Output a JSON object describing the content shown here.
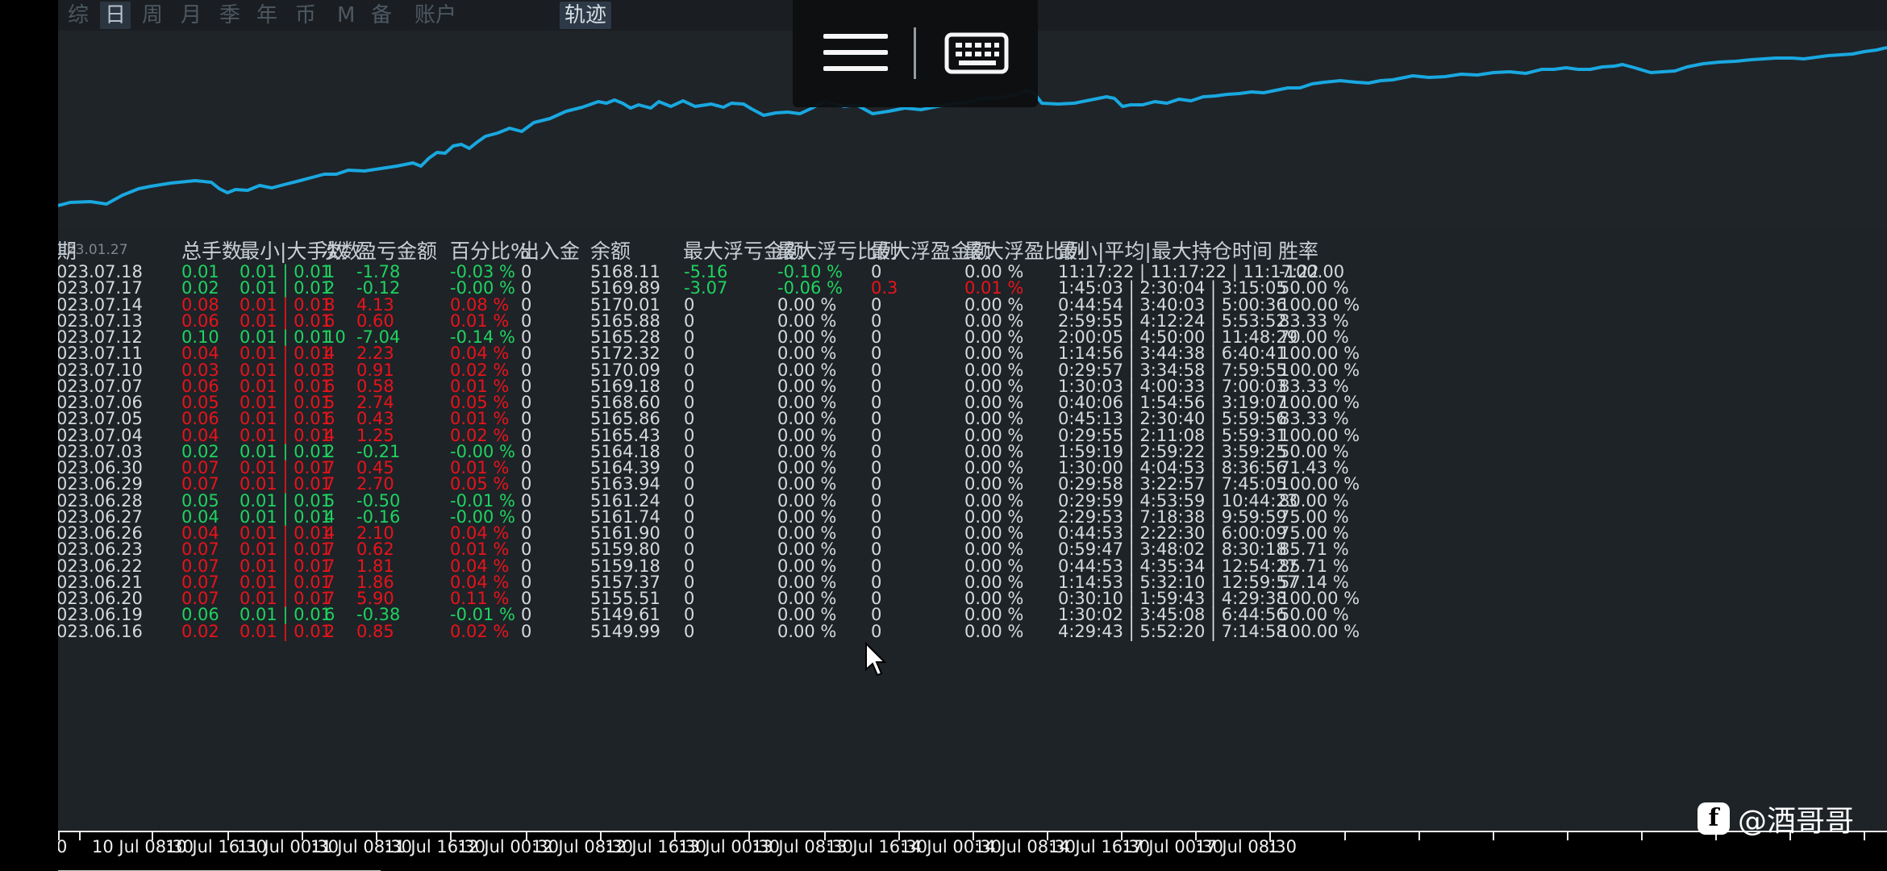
{
  "toolbar": {
    "periods": [
      "综",
      "日",
      "周",
      "月",
      "季",
      "年",
      "币",
      "M",
      "备",
      "账户"
    ],
    "active_period": "日",
    "track_button": "轨迹"
  },
  "chart": {
    "start_label": "023.01.27",
    "line_color": "#19a8e0",
    "background": "#1f2429"
  },
  "overlay": {
    "left_icon": "hamburger-menu-icon",
    "right_icon": "keyboard-icon"
  },
  "table": {
    "headers": [
      "期",
      "总手数",
      "最小|大手数",
      "次数",
      "盈亏金额",
      "百分比%",
      "出入金",
      "余额",
      "最大浮亏金额",
      "最大浮亏比例",
      "最大浮盈金额",
      "最大浮盈比例",
      "最小|平均|最大持仓时间",
      "胜率"
    ],
    "rows": [
      {
        "date": "023.07.18",
        "lots": "0.01",
        "minmax": "0.01 | 0.01",
        "count": "1",
        "pnl": "-1.78",
        "pct": "-0.03 %",
        "inout": "0",
        "balance": "5168.11",
        "maxloss": "-5.16",
        "maxloss_pct": "-0.10 %",
        "maxprofit": "0",
        "maxprofit_pct": "0.00 %",
        "hold": "11:17:22 | 11:17:22 | 11:17:22",
        "win": "-100.00",
        "color": "g",
        "loss_color": "g",
        "profit_color": "w"
      },
      {
        "date": "023.07.17",
        "lots": "0.02",
        "minmax": "0.01 | 0.01",
        "count": "2",
        "pnl": "-0.12",
        "pct": "-0.00 %",
        "inout": "0",
        "balance": "5169.89",
        "maxloss": "-3.07",
        "maxloss_pct": "-0.06 %",
        "maxprofit": "0.3",
        "maxprofit_pct": "0.01 %",
        "hold": "1:45:03 | 2:30:04 | 3:15:05",
        "win": "50.00 %",
        "color": "g",
        "loss_color": "g",
        "profit_color": "r"
      },
      {
        "date": "023.07.14",
        "lots": "0.08",
        "minmax": "0.01 | 0.01",
        "count": "8",
        "pnl": "4.13",
        "pct": "0.08 %",
        "inout": "0",
        "balance": "5170.01",
        "maxloss": "0",
        "maxloss_pct": "0.00 %",
        "maxprofit": "0",
        "maxprofit_pct": "0.00 %",
        "hold": "0:44:54 | 3:40:03 | 5:00:36",
        "win": "100.00 %",
        "color": "r",
        "loss_color": "w",
        "profit_color": "w"
      },
      {
        "date": "023.07.13",
        "lots": "0.06",
        "minmax": "0.01 | 0.01",
        "count": "6",
        "pnl": "0.60",
        "pct": "0.01 %",
        "inout": "0",
        "balance": "5165.88",
        "maxloss": "0",
        "maxloss_pct": "0.00 %",
        "maxprofit": "0",
        "maxprofit_pct": "0.00 %",
        "hold": "2:59:55 | 4:12:24 | 5:53:52",
        "win": "83.33 %",
        "color": "r",
        "loss_color": "w",
        "profit_color": "w"
      },
      {
        "date": "023.07.12",
        "lots": "0.10",
        "minmax": "0.01 | 0.01",
        "count": "10",
        "pnl": "-7.04",
        "pct": "-0.14 %",
        "inout": "0",
        "balance": "5165.28",
        "maxloss": "0",
        "maxloss_pct": "0.00 %",
        "maxprofit": "0",
        "maxprofit_pct": "0.00 %",
        "hold": "2:00:05 | 4:50:00 | 11:48:29",
        "win": "70.00 %",
        "color": "g",
        "loss_color": "w",
        "profit_color": "w"
      },
      {
        "date": "023.07.11",
        "lots": "0.04",
        "minmax": "0.01 | 0.01",
        "count": "4",
        "pnl": "2.23",
        "pct": "0.04 %",
        "inout": "0",
        "balance": "5172.32",
        "maxloss": "0",
        "maxloss_pct": "0.00 %",
        "maxprofit": "0",
        "maxprofit_pct": "0.00 %",
        "hold": "1:14:56 | 3:44:38 | 6:40:41",
        "win": "100.00 %",
        "color": "r",
        "loss_color": "w",
        "profit_color": "w"
      },
      {
        "date": "023.07.10",
        "lots": "0.03",
        "minmax": "0.01 | 0.01",
        "count": "3",
        "pnl": "0.91",
        "pct": "0.02 %",
        "inout": "0",
        "balance": "5170.09",
        "maxloss": "0",
        "maxloss_pct": "0.00 %",
        "maxprofit": "0",
        "maxprofit_pct": "0.00 %",
        "hold": "0:29:57 | 3:34:58 | 7:59:55",
        "win": "100.00 %",
        "color": "r",
        "loss_color": "w",
        "profit_color": "w"
      },
      {
        "date": "023.07.07",
        "lots": "0.06",
        "minmax": "0.01 | 0.01",
        "count": "6",
        "pnl": "0.58",
        "pct": "0.01 %",
        "inout": "0",
        "balance": "5169.18",
        "maxloss": "0",
        "maxloss_pct": "0.00 %",
        "maxprofit": "0",
        "maxprofit_pct": "0.00 %",
        "hold": "1:30:03 | 4:00:33 | 7:00:03",
        "win": "83.33 %",
        "color": "r",
        "loss_color": "w",
        "profit_color": "w"
      },
      {
        "date": "023.07.06",
        "lots": "0.05",
        "minmax": "0.01 | 0.01",
        "count": "5",
        "pnl": "2.74",
        "pct": "0.05 %",
        "inout": "0",
        "balance": "5168.60",
        "maxloss": "0",
        "maxloss_pct": "0.00 %",
        "maxprofit": "0",
        "maxprofit_pct": "0.00 %",
        "hold": "0:40:06 | 1:54:56 | 3:19:07",
        "win": "100.00 %",
        "color": "r",
        "loss_color": "w",
        "profit_color": "w"
      },
      {
        "date": "023.07.05",
        "lots": "0.06",
        "minmax": "0.01 | 0.01",
        "count": "6",
        "pnl": "0.43",
        "pct": "0.01 %",
        "inout": "0",
        "balance": "5165.86",
        "maxloss": "0",
        "maxloss_pct": "0.00 %",
        "maxprofit": "0",
        "maxprofit_pct": "0.00 %",
        "hold": "0:45:13 | 2:30:40 | 5:59:56",
        "win": "83.33 %",
        "color": "r",
        "loss_color": "w",
        "profit_color": "w"
      },
      {
        "date": "023.07.04",
        "lots": "0.04",
        "minmax": "0.01 | 0.01",
        "count": "4",
        "pnl": "1.25",
        "pct": "0.02 %",
        "inout": "0",
        "balance": "5165.43",
        "maxloss": "0",
        "maxloss_pct": "0.00 %",
        "maxprofit": "0",
        "maxprofit_pct": "0.00 %",
        "hold": "0:29:55 | 2:11:08 | 5:59:31",
        "win": "100.00 %",
        "color": "r",
        "loss_color": "w",
        "profit_color": "w"
      },
      {
        "date": "023.07.03",
        "lots": "0.02",
        "minmax": "0.01 | 0.01",
        "count": "2",
        "pnl": "-0.21",
        "pct": "-0.00 %",
        "inout": "0",
        "balance": "5164.18",
        "maxloss": "0",
        "maxloss_pct": "0.00 %",
        "maxprofit": "0",
        "maxprofit_pct": "0.00 %",
        "hold": "1:59:19 | 2:59:22 | 3:59:25",
        "win": "50.00 %",
        "color": "g",
        "loss_color": "w",
        "profit_color": "w"
      },
      {
        "date": "023.06.30",
        "lots": "0.07",
        "minmax": "0.01 | 0.01",
        "count": "7",
        "pnl": "0.45",
        "pct": "0.01 %",
        "inout": "0",
        "balance": "5164.39",
        "maxloss": "0",
        "maxloss_pct": "0.00 %",
        "maxprofit": "0",
        "maxprofit_pct": "0.00 %",
        "hold": "1:30:00 | 4:04:53 | 8:36:56",
        "win": "71.43 %",
        "color": "r",
        "loss_color": "w",
        "profit_color": "w"
      },
      {
        "date": "023.06.29",
        "lots": "0.07",
        "minmax": "0.01 | 0.01",
        "count": "7",
        "pnl": "2.70",
        "pct": "0.05 %",
        "inout": "0",
        "balance": "5163.94",
        "maxloss": "0",
        "maxloss_pct": "0.00 %",
        "maxprofit": "0",
        "maxprofit_pct": "0.00 %",
        "hold": "0:29:58 | 3:22:57 | 7:45:05",
        "win": "100.00 %",
        "color": "r",
        "loss_color": "w",
        "profit_color": "w"
      },
      {
        "date": "023.06.28",
        "lots": "0.05",
        "minmax": "0.01 | 0.01",
        "count": "5",
        "pnl": "-0.50",
        "pct": "-0.01 %",
        "inout": "0",
        "balance": "5161.24",
        "maxloss": "0",
        "maxloss_pct": "0.00 %",
        "maxprofit": "0",
        "maxprofit_pct": "0.00 %",
        "hold": "0:29:59 | 4:53:59 | 10:44:23",
        "win": "80.00 %",
        "color": "g",
        "loss_color": "w",
        "profit_color": "w"
      },
      {
        "date": "023.06.27",
        "lots": "0.04",
        "minmax": "0.01 | 0.01",
        "count": "4",
        "pnl": "-0.16",
        "pct": "-0.00 %",
        "inout": "0",
        "balance": "5161.74",
        "maxloss": "0",
        "maxloss_pct": "0.00 %",
        "maxprofit": "0",
        "maxprofit_pct": "0.00 %",
        "hold": "2:29:53 | 7:18:38 | 9:59:59",
        "win": "75.00 %",
        "color": "g",
        "loss_color": "w",
        "profit_color": "w"
      },
      {
        "date": "023.06.26",
        "lots": "0.04",
        "minmax": "0.01 | 0.01",
        "count": "4",
        "pnl": "2.10",
        "pct": "0.04 %",
        "inout": "0",
        "balance": "5161.90",
        "maxloss": "0",
        "maxloss_pct": "0.00 %",
        "maxprofit": "0",
        "maxprofit_pct": "0.00 %",
        "hold": "0:44:53 | 2:22:30 | 6:00:09",
        "win": "75.00 %",
        "color": "r",
        "loss_color": "w",
        "profit_color": "w"
      },
      {
        "date": "023.06.23",
        "lots": "0.07",
        "minmax": "0.01 | 0.01",
        "count": "7",
        "pnl": "0.62",
        "pct": "0.01 %",
        "inout": "0",
        "balance": "5159.80",
        "maxloss": "0",
        "maxloss_pct": "0.00 %",
        "maxprofit": "0",
        "maxprofit_pct": "0.00 %",
        "hold": "0:59:47 | 3:48:02 | 8:30:18",
        "win": "85.71 %",
        "color": "r",
        "loss_color": "w",
        "profit_color": "w"
      },
      {
        "date": "023.06.22",
        "lots": "0.07",
        "minmax": "0.01 | 0.01",
        "count": "7",
        "pnl": "1.81",
        "pct": "0.04 %",
        "inout": "0",
        "balance": "5159.18",
        "maxloss": "0",
        "maxloss_pct": "0.00 %",
        "maxprofit": "0",
        "maxprofit_pct": "0.00 %",
        "hold": "0:44:53 | 4:35:34 | 12:54:27",
        "win": "85.71 %",
        "color": "r",
        "loss_color": "w",
        "profit_color": "w"
      },
      {
        "date": "023.06.21",
        "lots": "0.07",
        "minmax": "0.01 | 0.01",
        "count": "7",
        "pnl": "1.86",
        "pct": "0.04 %",
        "inout": "0",
        "balance": "5157.37",
        "maxloss": "0",
        "maxloss_pct": "0.00 %",
        "maxprofit": "0",
        "maxprofit_pct": "0.00 %",
        "hold": "1:14:53 | 5:32:10 | 12:59:57",
        "win": "57.14 %",
        "color": "r",
        "loss_color": "w",
        "profit_color": "w"
      },
      {
        "date": "023.06.20",
        "lots": "0.07",
        "minmax": "0.01 | 0.01",
        "count": "7",
        "pnl": "5.90",
        "pct": "0.11 %",
        "inout": "0",
        "balance": "5155.51",
        "maxloss": "0",
        "maxloss_pct": "0.00 %",
        "maxprofit": "0",
        "maxprofit_pct": "0.00 %",
        "hold": "0:30:10 | 1:59:43 | 4:29:38",
        "win": "100.00 %",
        "color": "r",
        "loss_color": "w",
        "profit_color": "w"
      },
      {
        "date": "023.06.19",
        "lots": "0.06",
        "minmax": "0.01 | 0.01",
        "count": "6",
        "pnl": "-0.38",
        "pct": "-0.01 %",
        "inout": "0",
        "balance": "5149.61",
        "maxloss": "0",
        "maxloss_pct": "0.00 %",
        "maxprofit": "0",
        "maxprofit_pct": "0.00 %",
        "hold": "1:30:02 | 3:45:08 | 6:44:56",
        "win": "50.00 %",
        "color": "g",
        "loss_color": "w",
        "profit_color": "w"
      },
      {
        "date": "023.06.16",
        "lots": "0.02",
        "minmax": "0.01 | 0.01",
        "count": "2",
        "pnl": "0.85",
        "pct": "0.02 %",
        "inout": "0",
        "balance": "5149.99",
        "maxloss": "0",
        "maxloss_pct": "0.00 %",
        "maxprofit": "0",
        "maxprofit_pct": "0.00 %",
        "hold": "4:29:43 | 5:52:20 | 7:14:58",
        "win": "100.00 %",
        "color": "r",
        "loss_color": "w",
        "profit_color": "w"
      }
    ]
  },
  "time_axis": {
    "labels": [
      "0",
      "10 Jul 08:30",
      "10 Jul 16:30",
      "11 Jul 00:30",
      "11 Jul 08:30",
      "11 Jul 16:30",
      "12 Jul 00:30",
      "12 Jul 08:30",
      "12 Jul 16:30",
      "13 Jul 00:30",
      "13 Jul 08:30",
      "13 Jul 16:30",
      "14 Jul 00:30",
      "14 Jul 08:30",
      "14 Jul 16:30",
      "17 Jul 00:30",
      "17 Jul 08:30",
      "1"
    ]
  },
  "watermark": {
    "logo_letter": "f",
    "text": "@酒哥哥"
  }
}
